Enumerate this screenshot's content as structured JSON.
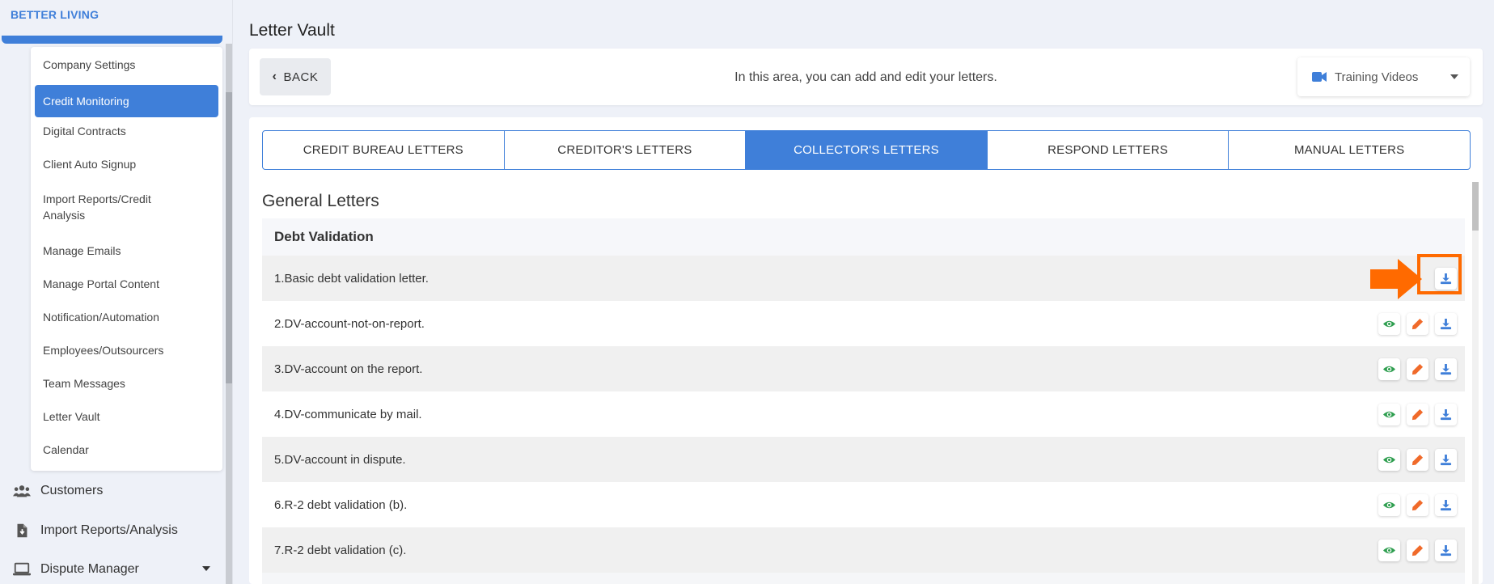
{
  "brand": "BETTER LIVING",
  "sidebar": {
    "submenu": [
      {
        "label": "Company Settings"
      },
      {
        "label": "Credit Monitoring",
        "active": true
      },
      {
        "label": "Digital Contracts"
      },
      {
        "label": "Client Auto Signup"
      },
      {
        "label": "Import Reports/Credit Analysis"
      },
      {
        "label": "Manage Emails"
      },
      {
        "label": "Manage Portal Content"
      },
      {
        "label": "Notification/Automation"
      },
      {
        "label": "Employees/Outsourcers"
      },
      {
        "label": "Team Messages"
      },
      {
        "label": "Letter Vault"
      },
      {
        "label": "Calendar"
      }
    ],
    "nav": [
      {
        "label": "Customers",
        "icon": "users-icon"
      },
      {
        "label": "Import Reports/Analysis",
        "icon": "file-import-icon"
      },
      {
        "label": "Dispute Manager",
        "icon": "laptop-icon"
      }
    ]
  },
  "page": {
    "title": "Letter Vault",
    "back_label": "BACK",
    "info": "In this area, you can add and edit your letters.",
    "training_label": "Training Videos"
  },
  "tabs": [
    {
      "label": "CREDIT BUREAU LETTERS"
    },
    {
      "label": "CREDITOR'S LETTERS"
    },
    {
      "label": "COLLECTOR'S LETTERS",
      "active": true
    },
    {
      "label": "RESPOND LETTERS"
    },
    {
      "label": "MANUAL LETTERS"
    }
  ],
  "section_title": "General Letters",
  "group": {
    "title": "Debt Validation",
    "letters": [
      {
        "label": "1.Basic debt validation letter."
      },
      {
        "label": "2.DV-account-not-on-report."
      },
      {
        "label": "3.DV-account on the report."
      },
      {
        "label": "4.DV-communicate by mail."
      },
      {
        "label": "5.DV-account in dispute."
      },
      {
        "label": "6.R-2 debt validation (b)."
      },
      {
        "label": "7.R-2 debt validation (c)."
      }
    ]
  },
  "colors": {
    "primary": "#3f7fd9",
    "view": "#2e9e4f",
    "edit": "#f06a2a",
    "download": "#3f7fd9",
    "highlight": "#ff6a00"
  }
}
